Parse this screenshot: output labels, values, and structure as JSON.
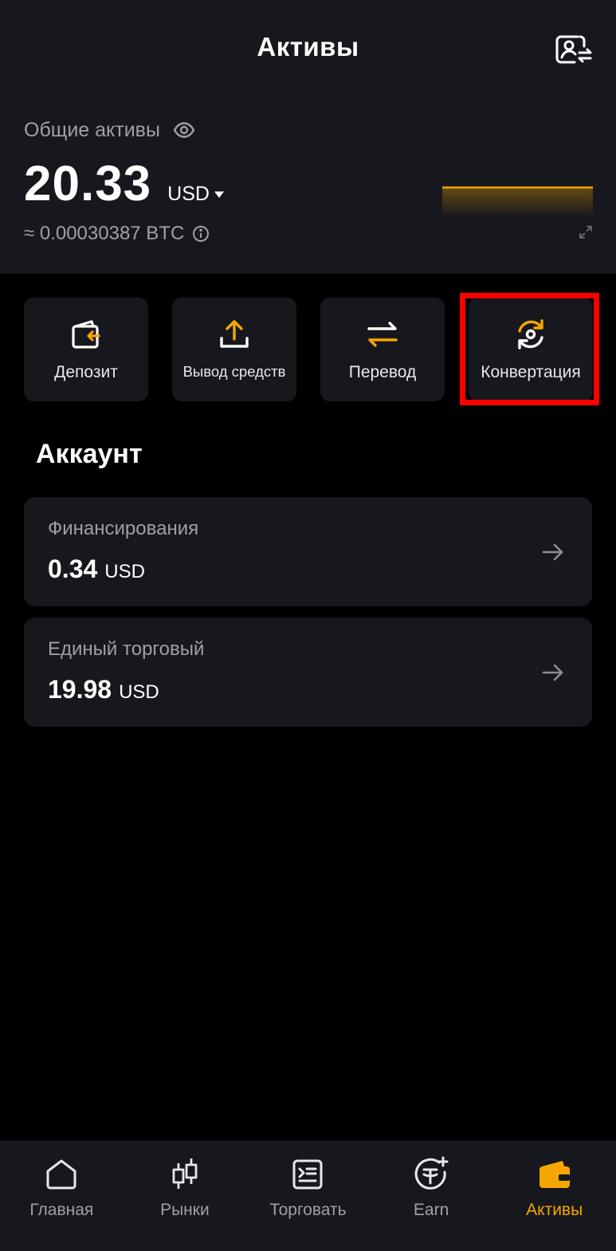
{
  "header": {
    "title": "Активы",
    "account_switch_icon": "user-swap-icon"
  },
  "summary": {
    "total_label": "Общие активы",
    "visibility_icon": "eye-icon",
    "balance": "20.33",
    "currency": "USD",
    "btc_equivalent": "≈ 0.00030387 BTC",
    "info_icon": "info-icon",
    "sparkline_color": "#f7a600"
  },
  "actions": [
    {
      "label": "Депозит",
      "icon": "deposit-icon"
    },
    {
      "label": "Вывод средств",
      "icon": "upload-icon"
    },
    {
      "label": "Перевод",
      "icon": "transfer-icon"
    },
    {
      "label": "Конвертация",
      "icon": "convert-icon"
    }
  ],
  "accounts": {
    "title": "Аккаунт",
    "items": [
      {
        "name": "Финансирования",
        "amount": "0.34",
        "currency": "USD"
      },
      {
        "name": "Единый торговый",
        "amount": "19.98",
        "currency": "USD"
      }
    ]
  },
  "nav": {
    "items": [
      {
        "label": "Главная",
        "icon": "home-icon",
        "active": false
      },
      {
        "label": "Рынки",
        "icon": "candlestick-icon",
        "active": false
      },
      {
        "label": "Торговать",
        "icon": "trade-terminal-icon",
        "active": false
      },
      {
        "label": "Earn",
        "icon": "earn-coin-icon",
        "active": false
      },
      {
        "label": "Активы",
        "icon": "wallet-icon",
        "active": true
      }
    ]
  },
  "colors": {
    "accent": "#f7a600",
    "highlight": "#ff0000",
    "card_bg": "#17181d",
    "muted_text": "#9ea0a8"
  }
}
